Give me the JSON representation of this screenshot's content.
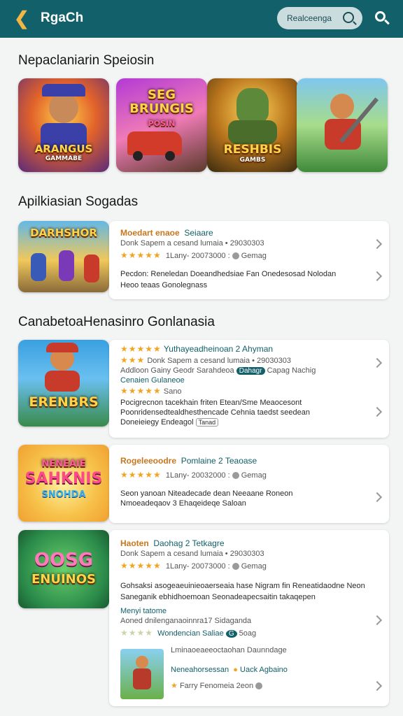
{
  "header": {
    "title": "RgaCh",
    "search_placeholder": "Realceenga"
  },
  "sections": {
    "featured_title": "Nepaclaniarin Speiosin",
    "apps_title": "Apilkiasian Sogadas",
    "more_title": "CanabetoaHenasinro Gonlanasia"
  },
  "featured": [
    {
      "label": "ARANGUS",
      "sub": "GAMMABE"
    },
    {
      "label": "SEG BRUNGIS",
      "sub": "POSIN"
    },
    {
      "label": "RESHBIS",
      "sub": "GAMBS"
    },
    {
      "label": "",
      "sub": ""
    }
  ],
  "card1": {
    "thumb_label": "DARHSHOR",
    "title": "Moedart enaoe",
    "title_tag": "Seiaare",
    "meta": "Donk Sapem a cesand lumaia • 29030303",
    "stars": "★★★★★",
    "stars_meta": "1Lany- 20073000 :",
    "badge": "Gemag",
    "desc": "Pecdon: Reneledan Doeandhedsiae Fan Onedesosad Nolodan",
    "desc2": "Heoo teaas Gonolegnass"
  },
  "card2": {
    "thumb_label": "ERENBRS",
    "title_stars": "★★★★★",
    "title": "Yuthayeadheinoan 2 Ahyman",
    "row_stars": "★★★",
    "row_meta": "Donk Sapem a cesand lumaia • 29030303",
    "row3": "Addloon Gainy Geodr Sarahdeoa",
    "row3_tag": "Dahagr",
    "row3b": "Capag Nachig",
    "row4": "Cenaien Gulaneoe",
    "row5_stars": "★★★★★",
    "row5_meta": "Sano",
    "desc1": "Pocigrecnon tacekhain friten Etean/Sme Meaocesont",
    "desc2": "Poonridensedtealdhesthencade Cehnia taedst seedean",
    "desc3": "Doneieiegy Endeagol",
    "desc3_tag": "Tanad"
  },
  "card3": {
    "thumb_label": "SAHKNIS",
    "thumb_sub": "SNOHDA",
    "title": "Rogeleeoodre",
    "title_tag": "Pomlaine 2 Teaoase",
    "stars": "★★★★★",
    "stars_meta": "1Lany- 20032000 :",
    "badge": "Gemag",
    "desc1": "Seon yanoan Niteadecade dean Neeaane Roneon",
    "desc2": "Nmoeadeqaov 3 Ehaqeideqe Saloan"
  },
  "card4": {
    "thumb_label": "OOSG",
    "thumb_sub": "ENUINOS",
    "title": "Haoten",
    "title_tag": "Daohag 2 Tetkagre",
    "meta": "Donk Sapem a cesand lumaia • 29030303",
    "stars": "★★★★★",
    "stars_meta": "1Lany- 20073000 :",
    "badge": "Gemag",
    "desc1": "Gohsaksi asogeaeuinieoaerseaia hase Nigram fin Reneatidaodne Neon",
    "desc2": "Saneganik ebhidhoemoan Seonadeapecsaitin takaqepen",
    "sub_title": "Menyi tatome",
    "sub_desc": "Aoned dnilenganaoinnra17 Sidaganda",
    "sub_stars": "★★★★",
    "sub_tag": "Wondencian Saliae",
    "sub_num": "G",
    "sub_end": "5oag",
    "mini_title": "Lminaoeaeeoctaohan Daunndage",
    "mini_name": "Neneahorsessan",
    "mini_tag": "Uack Agbaino",
    "mini_meta": "Farry Fenomeia 2eon"
  }
}
